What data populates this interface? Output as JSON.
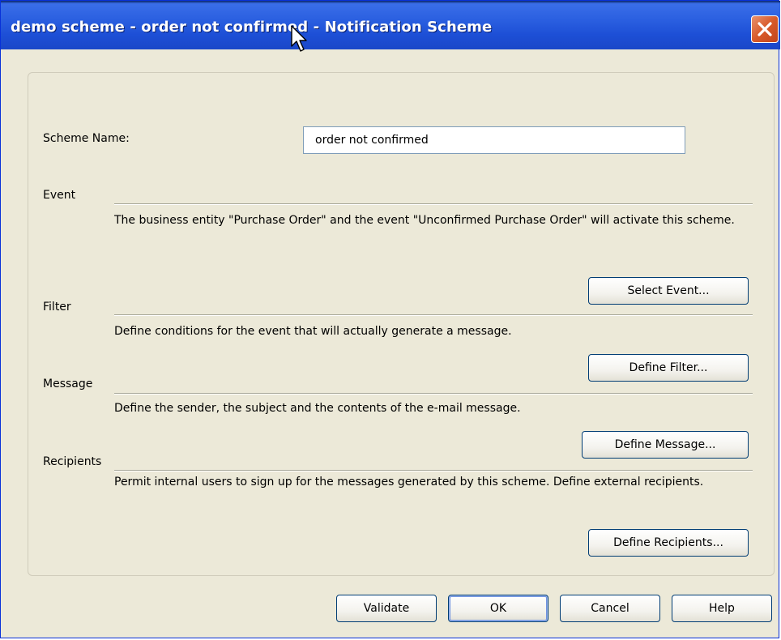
{
  "window": {
    "title": "demo scheme - order not confirmed - Notification Scheme"
  },
  "form": {
    "scheme_name_label": "Scheme Name:",
    "scheme_name_value": "order not confirmed",
    "sections": {
      "event": {
        "label": "Event",
        "description": "The business entity \"Purchase Order\" and the event \"Unconfirmed Purchase Order\" will activate this scheme.",
        "button": "Select Event..."
      },
      "filter": {
        "label": "Filter",
        "description": "Define conditions for the event that will actually generate a message.",
        "button": "Define Filter..."
      },
      "message": {
        "label": "Message",
        "description": "Define the sender, the subject and the contents of the e-mail message.",
        "button": "Define Message..."
      },
      "recipients": {
        "label": "Recipients",
        "description": "Permit internal users to sign up for the messages generated by this scheme. Define external recipients.",
        "button": "Define Recipients..."
      }
    }
  },
  "footer": {
    "validate": "Validate",
    "ok": "OK",
    "cancel": "Cancel",
    "help": "Help"
  }
}
